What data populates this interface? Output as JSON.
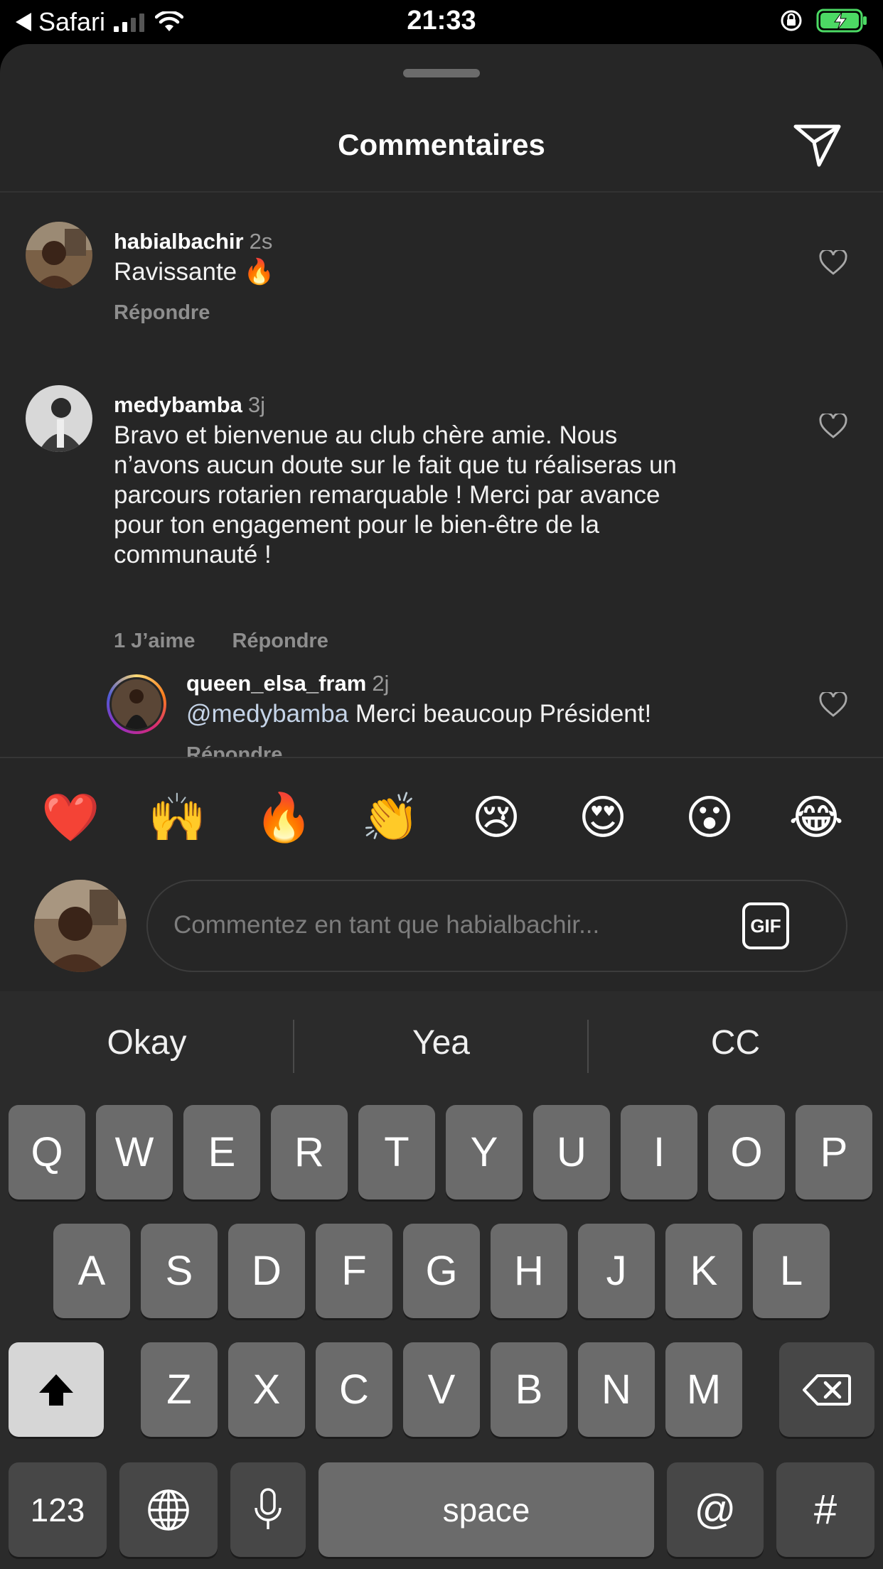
{
  "status_bar": {
    "back_app": "Safari",
    "time": "21:33"
  },
  "sheet": {
    "title": "Commentaires"
  },
  "comments": [
    {
      "username": "habialbachir",
      "time": "2s",
      "text": "Ravissante 🔥",
      "reply_label": "Répondre"
    },
    {
      "username": "medybamba",
      "time": "3j",
      "lines": [
        "Bravo et bienvenue au club chère amie. Nous",
        "n’avons aucun doute sur le fait que tu réaliseras un",
        "parcours rotarien remarquable ! Merci par avance",
        "pour ton engagement pour le bien-être de la",
        "communauté !"
      ],
      "likes_label": "1 J’aime",
      "reply_label": "Répondre"
    },
    {
      "username": "queen_elsa_fram",
      "time": "2j",
      "mention": "@medybamba",
      "text": " Merci beaucoup Président!",
      "reply_label": "Répondre"
    }
  ],
  "emoji_bar": [
    "❤️",
    "🙌",
    "🔥",
    "👏",
    "😢",
    "😍",
    "😮",
    "😂"
  ],
  "composer": {
    "placeholder": "Commentez en tant que habialbachir...",
    "gif_label": "GIF"
  },
  "keyboard": {
    "suggestions": [
      "Okay",
      "Yea",
      "CC"
    ],
    "row1": [
      "Q",
      "W",
      "E",
      "R",
      "T",
      "Y",
      "U",
      "I",
      "O",
      "P"
    ],
    "row2": [
      "A",
      "S",
      "D",
      "F",
      "G",
      "H",
      "J",
      "K",
      "L"
    ],
    "row3": [
      "Z",
      "X",
      "C",
      "V",
      "B",
      "N",
      "M"
    ],
    "numbers_label": "123",
    "space_label": "space",
    "at_label": "@",
    "hash_label": "#"
  },
  "colors": {
    "sheet_bg": "#262626",
    "keyboard_bg": "#2b2b2b",
    "key_bg": "#6b6b6b",
    "battery_green": "#4cd964"
  }
}
